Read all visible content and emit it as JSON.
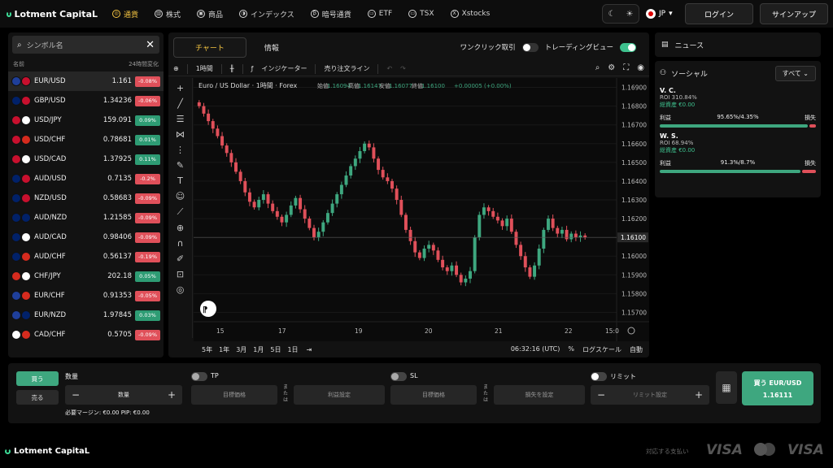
{
  "brand": "Lotment CapitaL",
  "nav": [
    {
      "label": "通貨",
      "icon": "currency-icon",
      "active": true
    },
    {
      "label": "株式",
      "icon": "stocks-icon"
    },
    {
      "label": "商品",
      "icon": "commodities-icon"
    },
    {
      "label": "インデックス",
      "icon": "indices-icon"
    },
    {
      "label": "暗号通貨",
      "icon": "crypto-icon"
    },
    {
      "label": "ETF",
      "icon": "etf-icon"
    },
    {
      "label": "TSX",
      "icon": "tsx-icon"
    },
    {
      "label": "Xstocks",
      "icon": "xstocks-icon"
    }
  ],
  "header": {
    "lang": "JP",
    "login": "ログイン",
    "signup": "サインアップ"
  },
  "watchlist": {
    "search_placeholder": "シンボル名",
    "col_name": "名前",
    "col_change": "24時間変化",
    "rows": [
      {
        "symbol": "EUR/USD",
        "price": "1.161",
        "change": "-0.08%",
        "dir": "neg",
        "flags": [
          "#1f3f9a",
          "#c8102e"
        ]
      },
      {
        "symbol": "GBP/USD",
        "price": "1.34236",
        "change": "-0.06%",
        "dir": "neg",
        "flags": [
          "#012169",
          "#c8102e"
        ]
      },
      {
        "symbol": "USD/JPY",
        "price": "159.091",
        "change": "0.09%",
        "dir": "pos",
        "flags": [
          "#c8102e",
          "#ffffff"
        ]
      },
      {
        "symbol": "USD/CHF",
        "price": "0.78681",
        "change": "0.01%",
        "dir": "pos",
        "flags": [
          "#c8102e",
          "#d52b1e"
        ]
      },
      {
        "symbol": "USD/CAD",
        "price": "1.37925",
        "change": "0.11%",
        "dir": "pos",
        "flags": [
          "#c8102e",
          "#ffffff"
        ]
      },
      {
        "symbol": "AUD/USD",
        "price": "0.7135",
        "change": "-0.2%",
        "dir": "neg",
        "flags": [
          "#012169",
          "#c8102e"
        ]
      },
      {
        "symbol": "NZD/USD",
        "price": "0.58683",
        "change": "-0.09%",
        "dir": "neg",
        "flags": [
          "#012169",
          "#c8102e"
        ]
      },
      {
        "symbol": "AUD/NZD",
        "price": "1.21585",
        "change": "-0.09%",
        "dir": "neg",
        "flags": [
          "#012169",
          "#012169"
        ]
      },
      {
        "symbol": "AUD/CAD",
        "price": "0.98406",
        "change": "-0.09%",
        "dir": "neg",
        "flags": [
          "#012169",
          "#ffffff"
        ]
      },
      {
        "symbol": "AUD/CHF",
        "price": "0.56137",
        "change": "-0.19%",
        "dir": "neg",
        "flags": [
          "#012169",
          "#d52b1e"
        ]
      },
      {
        "symbol": "CHF/JPY",
        "price": "202.18",
        "change": "0.05%",
        "dir": "pos",
        "flags": [
          "#d52b1e",
          "#ffffff"
        ]
      },
      {
        "symbol": "EUR/CHF",
        "price": "0.91353",
        "change": "-0.05%",
        "dir": "neg",
        "flags": [
          "#1f3f9a",
          "#d52b1e"
        ]
      },
      {
        "symbol": "EUR/NZD",
        "price": "1.97845",
        "change": "0.03%",
        "dir": "pos",
        "flags": [
          "#1f3f9a",
          "#012169"
        ]
      },
      {
        "symbol": "CAD/CHF",
        "price": "0.5705",
        "change": "-0.09%",
        "dir": "neg",
        "flags": [
          "#ffffff",
          "#d52b1e"
        ]
      }
    ]
  },
  "chart": {
    "tab_chart": "チャート",
    "tab_info": "情報",
    "oneclick_label": "ワンクリック取引",
    "oneclick_on": false,
    "tradingview_label": "トレーディングビュー",
    "tradingview_on": true,
    "interval": "1時間",
    "indicators": "インジケーター",
    "order_line": "売り注文ライン",
    "title": "Euro / US Dollar · 1時間 · Forex",
    "ohlc": {
      "o_label": "始値",
      "o": "1.16094",
      "h_label": "高値",
      "h": "1.16147",
      "l_label": "安値",
      "l": "1.16077",
      "c_label": "終値",
      "c": "1.16100",
      "chg": "+0.00005 (+0.00%)"
    },
    "price_labels": [
      "1.16900",
      "1.16800",
      "1.16700",
      "1.16600",
      "1.16500",
      "1.16400",
      "1.16300",
      "1.16200",
      "1.16100",
      "1.16000",
      "1.15900",
      "1.15800",
      "1.15700"
    ],
    "last_price": "1.16100",
    "time_labels": [
      "15",
      "17",
      "19",
      "20",
      "21",
      "22",
      "15:0"
    ],
    "ranges": [
      "5年",
      "1年",
      "3月",
      "1月",
      "5日",
      "1日"
    ],
    "clock": "06:32:16 (UTC)",
    "percent": "%",
    "log_scale": "ログスケール",
    "auto": "自動"
  },
  "chart_data": {
    "type": "candlestick",
    "title": "Euro / US Dollar · 1時間 · Forex",
    "ylim": [
      1.1565,
      1.1695
    ],
    "y_ticks": [
      1.169,
      1.168,
      1.167,
      1.166,
      1.165,
      1.164,
      1.163,
      1.162,
      1.161,
      1.16,
      1.159,
      1.158,
      1.157
    ],
    "x_ticks": [
      "15",
      "17",
      "19",
      "20",
      "21",
      "22",
      "15:0"
    ],
    "close": [
      1.168,
      1.1676,
      1.1672,
      1.1668,
      1.1664,
      1.1659,
      1.1655,
      1.165,
      1.1645,
      1.164,
      1.1634,
      1.1629,
      1.1626,
      1.163,
      1.1633,
      1.1628,
      1.1624,
      1.1621,
      1.1618,
      1.1622,
      1.1627,
      1.1631,
      1.1625,
      1.162,
      1.1615,
      1.161,
      1.1613,
      1.1618,
      1.1623,
      1.1628,
      1.1633,
      1.1638,
      1.1643,
      1.1648,
      1.1652,
      1.1656,
      1.166,
      1.1658,
      1.1652,
      1.1646,
      1.1642,
      1.164,
      1.1636,
      1.163,
      1.1622,
      1.1614,
      1.1608,
      1.1602,
      1.1599,
      1.1604,
      1.1606,
      1.1603,
      1.1598,
      1.1594,
      1.1592,
      1.1595,
      1.159,
      1.1586,
      1.1588,
      1.1592,
      1.161,
      1.1622,
      1.1626,
      1.1624,
      1.1621,
      1.1619,
      1.1616,
      1.162,
      1.1613,
      1.1606,
      1.16,
      1.1594,
      1.1589,
      1.1595,
      1.1604,
      1.1614,
      1.162,
      1.1615,
      1.1612,
      1.1614,
      1.1609,
      1.1612,
      1.161,
      1.1611,
      1.161
    ]
  },
  "news": {
    "label": "ニュース"
  },
  "social": {
    "label": "ソーシャル",
    "filter": "すべて",
    "traders": [
      {
        "name": "V. C.",
        "roi": "ROI 310.84%",
        "equity": "総資産 €0.00",
        "profit_label": "利益",
        "ratio": "95.65%/4.35%",
        "loss_label": "損失",
        "profit_share": 0.9565
      },
      {
        "name": "W. S.",
        "roi": "ROI 68.94%",
        "equity": "総資産 €0.00",
        "profit_label": "利益",
        "ratio": "91.3%/8.7%",
        "loss_label": "損失",
        "profit_share": 0.913
      }
    ]
  },
  "order": {
    "buy": "買う",
    "sell": "売る",
    "qty_label": "数量",
    "qty_placeholder": "数量",
    "tp_label": "TP",
    "sl_label": "SL",
    "limit_label": "リミット",
    "target_price": "目標価格",
    "or": "または",
    "profit_setting": "利益設定",
    "loss_setting": "損失を設定",
    "limit_setting": "リミット設定",
    "margin": "必要マージン: €0.00   PIP: €0.00",
    "buy_button": "買う EUR/USD",
    "buy_price": "1.16111"
  },
  "footer": {
    "brand": "Lotment CapitaL",
    "payments": "対応する支払い",
    "visa": "VISA",
    "visa_electron": "VISA"
  },
  "colors": {
    "up": "#3ea77f",
    "down": "#e0505a",
    "accent": "#f5c542"
  }
}
